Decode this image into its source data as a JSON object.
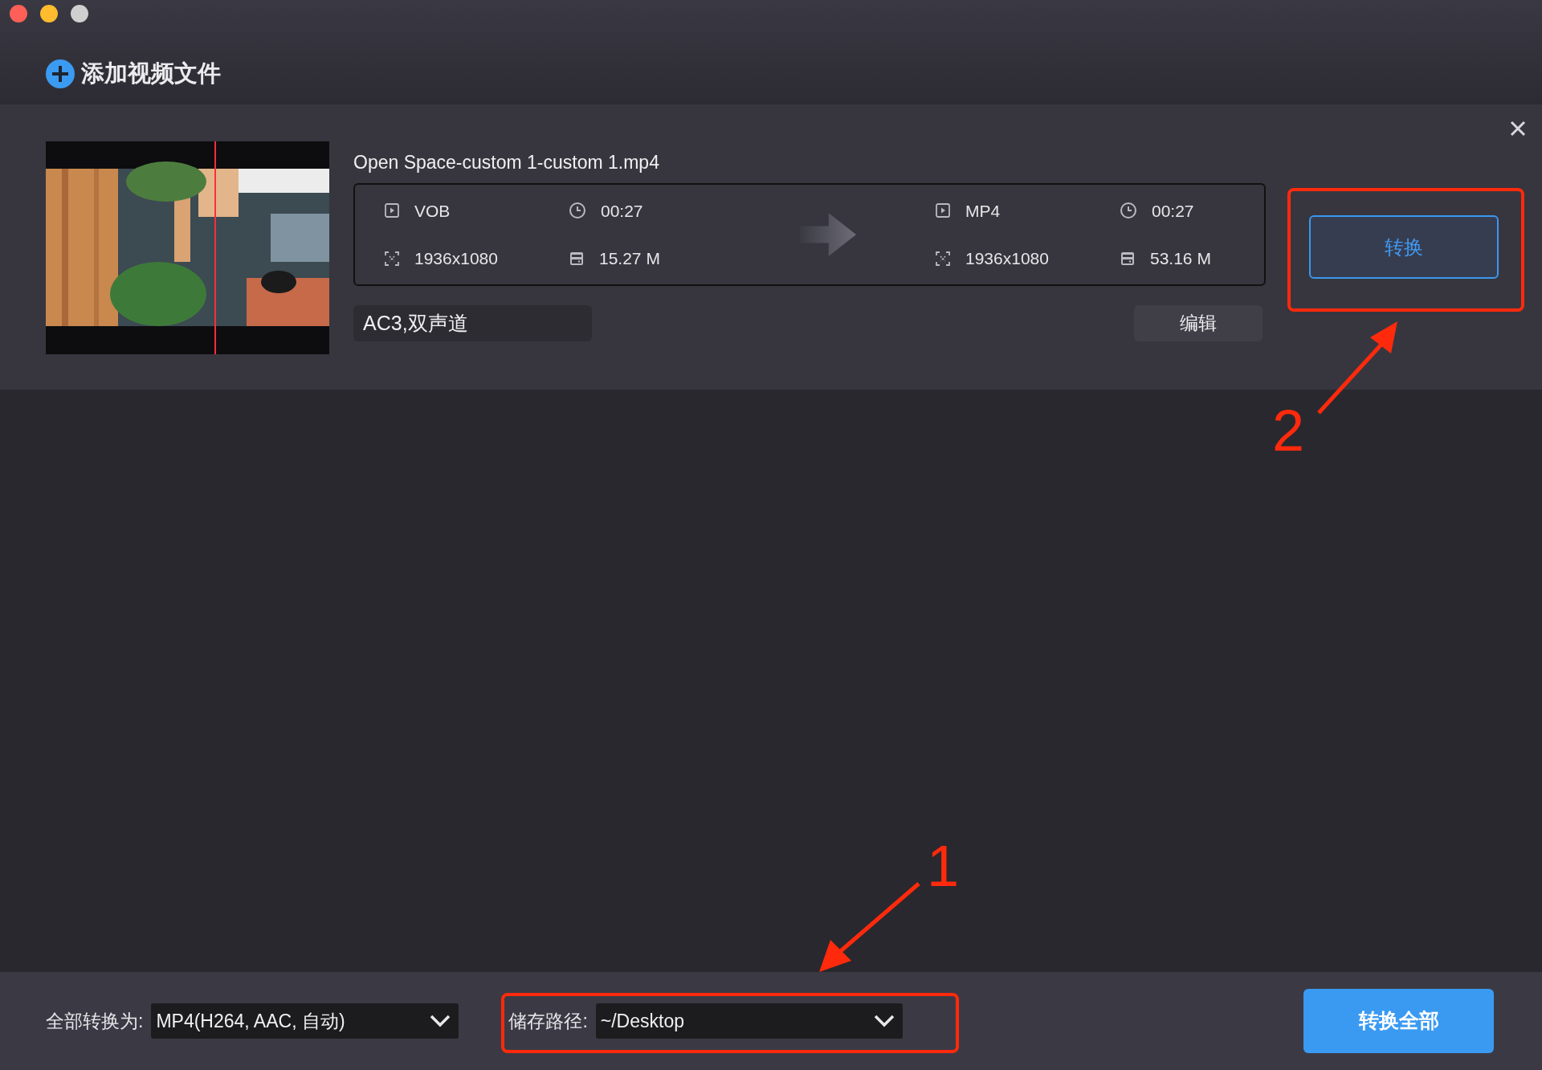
{
  "window": {
    "traffic_lights": [
      {
        "color": "#fe5f57"
      },
      {
        "color": "#febc2e"
      },
      {
        "color": "#cfcfcf"
      }
    ]
  },
  "add_button": {
    "label": "添加视频文件"
  },
  "files": [
    {
      "name": "Open Space-custom 1-custom 1.mp4",
      "source": {
        "format": "VOB",
        "duration": "00:27",
        "resolution": "1936x1080",
        "size": "15.27 M"
      },
      "target": {
        "format": "MP4",
        "duration": "00:27",
        "resolution": "1936x1080",
        "size": "53.16 M"
      },
      "audio": "AC3,双声道",
      "edit_label": "编辑",
      "convert_label": "转换"
    }
  ],
  "bottom_bar": {
    "convert_all_label": "全部转换为:",
    "format_value": "MP4(H264, AAC, 自动)",
    "path_label": "储存路径:",
    "path_value": "~/Desktop",
    "convert_all_button": "转换全部"
  },
  "annotations": [
    {
      "label": "2"
    },
    {
      "label": "1"
    }
  ]
}
